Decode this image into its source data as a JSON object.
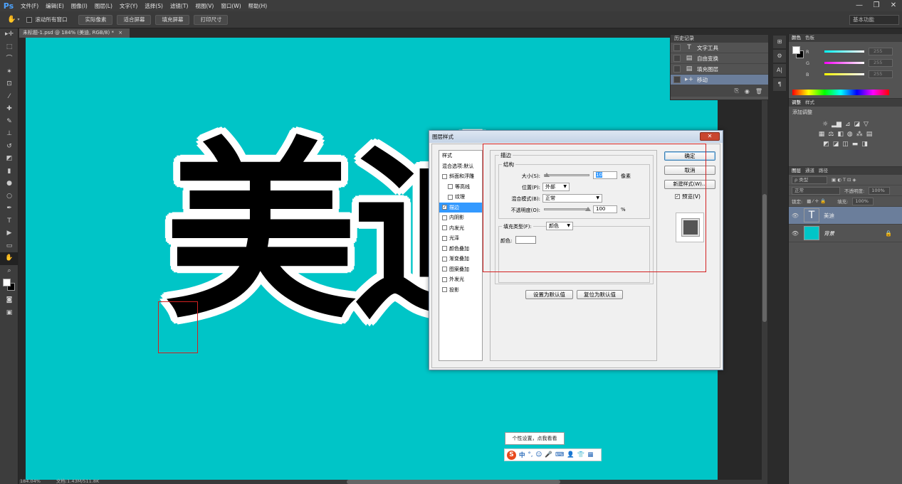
{
  "app": {
    "logo": "Ps"
  },
  "menubar": {
    "items": [
      "文件(F)",
      "编辑(E)",
      "图像(I)",
      "图层(L)",
      "文字(Y)",
      "选择(S)",
      "滤镜(T)",
      "视图(V)",
      "窗口(W)",
      "帮助(H)"
    ],
    "minimize": "—",
    "restore": "❐",
    "close": "✕"
  },
  "options": {
    "scroll_all": "滚动所有窗口",
    "btn_actual": "实际像素",
    "btn_fit": "适合屏幕",
    "btn_fill": "填充屏幕",
    "btn_print": "打印尺寸",
    "workspace": "基本功能"
  },
  "document": {
    "tab": "未标题-1.psd @ 184% (美迪, RGB/8) *",
    "zoom": "184.04%",
    "file_info": "文档:1.43M/511.8K",
    "canvas_text": "美迪",
    "canvas_color": "#00c5c7"
  },
  "history": {
    "tab": "历史记录",
    "items": [
      {
        "icon": "T",
        "label": "文字工具"
      },
      {
        "icon": "▤",
        "label": "自由变换"
      },
      {
        "icon": "▤",
        "label": "填充图层"
      },
      {
        "icon": "▸+",
        "label": "移动"
      }
    ]
  },
  "color_panel": {
    "tab_color": "颜色",
    "tab_swatches": "色板",
    "r_label": "R",
    "g_label": "G",
    "b_label": "B",
    "r_value": "255",
    "g_value": "255",
    "b_value": "255"
  },
  "adjust_panel": {
    "tab_adjust": "调整",
    "tab_styles": "样式",
    "label": "添加调整"
  },
  "layers_panel": {
    "tab_layers": "图层",
    "tab_channels": "通道",
    "tab_paths": "路径",
    "kind": "ρ 类型",
    "blend": "正常",
    "opacity_label": "不透明度:",
    "opacity_value": "100%",
    "lock_label": "锁定:",
    "fill_label": "填充:",
    "fill_value": "100%",
    "layers": [
      {
        "name": "美迪",
        "thumb": "T"
      },
      {
        "name": "背景",
        "thumb": ""
      }
    ]
  },
  "dialog": {
    "title": "图层样式",
    "close": "✕",
    "style_list": [
      {
        "label": "样式",
        "check": false,
        "hasbox": false,
        "indent": false,
        "sel": false
      },
      {
        "label": "混合选项:默认",
        "check": false,
        "hasbox": false,
        "indent": false,
        "sel": false
      },
      {
        "label": "斜面和浮雕",
        "check": false,
        "hasbox": true,
        "indent": false,
        "sel": false
      },
      {
        "label": "等高线",
        "check": false,
        "hasbox": true,
        "indent": true,
        "sel": false
      },
      {
        "label": "纹理",
        "check": false,
        "hasbox": true,
        "indent": true,
        "sel": false
      },
      {
        "label": "描边",
        "check": true,
        "hasbox": true,
        "indent": false,
        "sel": true
      },
      {
        "label": "内阴影",
        "check": false,
        "hasbox": true,
        "indent": false,
        "sel": false
      },
      {
        "label": "内发光",
        "check": false,
        "hasbox": true,
        "indent": false,
        "sel": false
      },
      {
        "label": "光泽",
        "check": false,
        "hasbox": true,
        "indent": false,
        "sel": false
      },
      {
        "label": "颜色叠加",
        "check": false,
        "hasbox": true,
        "indent": false,
        "sel": false
      },
      {
        "label": "渐变叠加",
        "check": false,
        "hasbox": true,
        "indent": false,
        "sel": false
      },
      {
        "label": "图案叠加",
        "check": false,
        "hasbox": true,
        "indent": false,
        "sel": false
      },
      {
        "label": "外发光",
        "check": false,
        "hasbox": true,
        "indent": false,
        "sel": false
      },
      {
        "label": "投影",
        "check": false,
        "hasbox": true,
        "indent": false,
        "sel": false
      }
    ],
    "stroke_group": "描边",
    "structure_group": "结构",
    "size_label": "大小(S):",
    "size_value": "10",
    "size_unit": "像素",
    "position_label": "位置(P):",
    "position_value": "外部",
    "blend_label": "混合模式(B):",
    "blend_value": "正常",
    "opacity_label": "不透明度(O):",
    "opacity_value": "100",
    "opacity_unit": "%",
    "fill_type_label": "填充类型(F):",
    "fill_type_value": "颜色",
    "color_label": "颜色:",
    "set_default": "设置为默认值",
    "reset_default": "复位为默认值",
    "ok": "确定",
    "cancel": "取消",
    "new_style": "新建样式(W)...",
    "preview_label": "预览(V)",
    "preview_checked": "✓"
  },
  "ime": {
    "tip": "个性设置，点我看看",
    "logo": "S",
    "lang": "中",
    "punct": "°,",
    "emoji": "☺",
    "voice": "🎤",
    "keyboard": "⌨",
    "user": "👤",
    "skin": "👕",
    "tools": "▦"
  }
}
